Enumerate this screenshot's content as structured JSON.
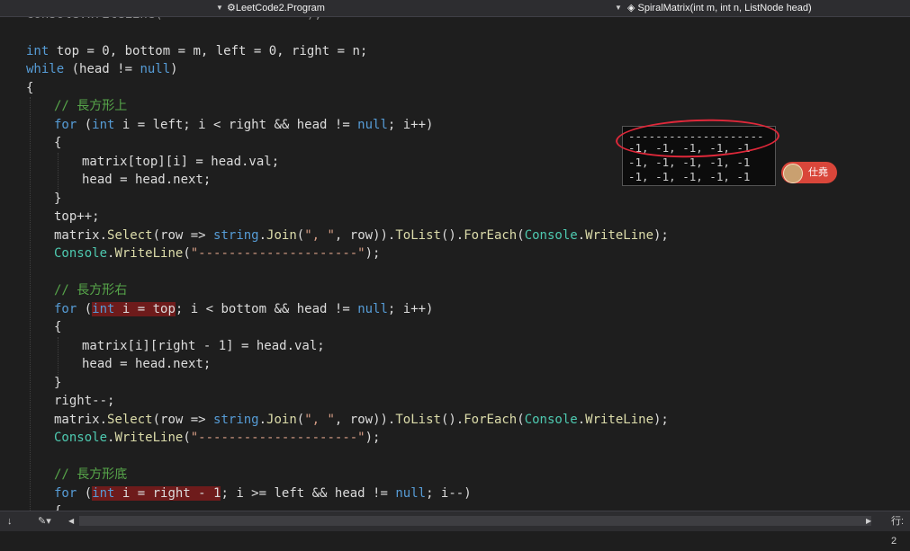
{
  "toolbar": {
    "class_dropdown": "LeetCode2.Program",
    "member_dropdown": "SpiralMatrix(int m, int n, ListNode head)"
  },
  "code": {
    "l0": "Console.WriteLine(",
    "l0b": ");",
    "comment_top": "// 長方形上",
    "comment_right": "// 長方形右",
    "comment_bottom": "// 長方形底",
    "dashes": "\"---------------------\""
  },
  "console": {
    "separator": "--------------------",
    "rows": [
      "-1, -1, -1, -1, -1",
      "-1, -1, -1, -1, -1",
      "-1, -1, -1, -1, -1"
    ]
  },
  "overlay": {
    "user_name": "仕堯"
  },
  "statusbar": {
    "line_label": "行: 2"
  }
}
